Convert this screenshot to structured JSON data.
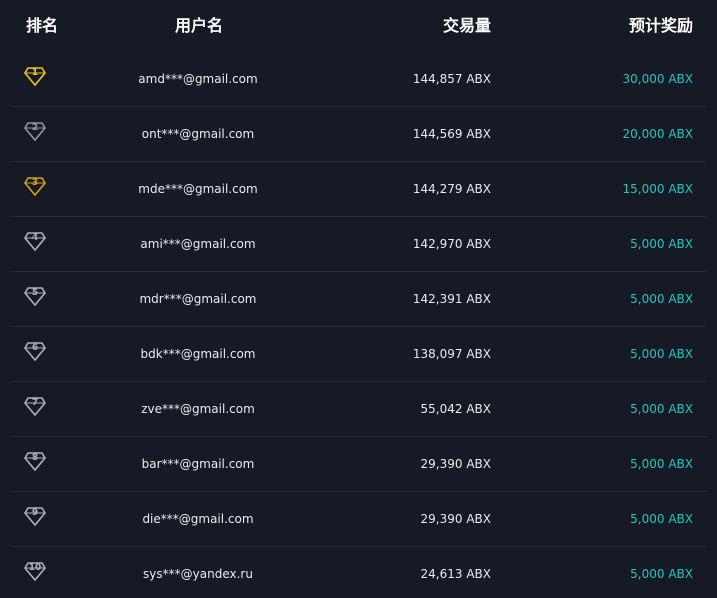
{
  "colors": {
    "background": "#161a25",
    "divider": "#272c38",
    "text": "#eaecef",
    "reward": "#1fc7c1",
    "gold": "#f0c419",
    "silver": "#8c97a8",
    "bronze": "#d4a017",
    "default_badge": "#aab2bf"
  },
  "header": {
    "rank": "排名",
    "username": "用户名",
    "volume": "交易量",
    "reward": "预计奖励"
  },
  "rows": [
    {
      "rank": "1",
      "badge_icon": "gold-diamond-icon",
      "user": "amd***@gmail.com",
      "volume": "144,857 ABX",
      "reward": "30,000 ABX"
    },
    {
      "rank": "2",
      "badge_icon": "silver-diamond-icon",
      "user": "ont***@gmail.com",
      "volume": "144,569 ABX",
      "reward": "20,000 ABX"
    },
    {
      "rank": "3",
      "badge_icon": "bronze-diamond-icon",
      "user": "mde***@gmail.com",
      "volume": "144,279 ABX",
      "reward": "15,000 ABX"
    },
    {
      "rank": "4",
      "badge_icon": "diamond-icon",
      "user": "ami***@gmail.com",
      "volume": "142,970 ABX",
      "reward": "5,000 ABX"
    },
    {
      "rank": "5",
      "badge_icon": "diamond-icon",
      "user": "mdr***@gmail.com",
      "volume": "142,391 ABX",
      "reward": "5,000 ABX"
    },
    {
      "rank": "6",
      "badge_icon": "diamond-icon",
      "user": "bdk***@gmail.com",
      "volume": "138,097 ABX",
      "reward": "5,000 ABX"
    },
    {
      "rank": "7",
      "badge_icon": "diamond-icon",
      "user": "zve***@gmail.com",
      "volume": "55,042 ABX",
      "reward": "5,000 ABX"
    },
    {
      "rank": "8",
      "badge_icon": "diamond-icon",
      "user": "bar***@gmail.com",
      "volume": "29,390 ABX",
      "reward": "5,000 ABX"
    },
    {
      "rank": "9",
      "badge_icon": "diamond-icon",
      "user": "die***@gmail.com",
      "volume": "29,390 ABX",
      "reward": "5,000 ABX"
    },
    {
      "rank": "10",
      "badge_icon": "diamond-icon",
      "user": "sys***@yandex.ru",
      "volume": "24,613 ABX",
      "reward": "5,000 ABX"
    }
  ]
}
